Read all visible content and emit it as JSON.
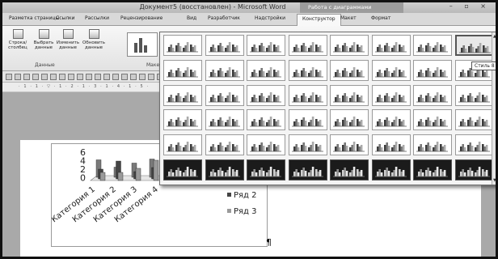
{
  "window": {
    "title": "Документ5 (восстановлен) - Microsoft Word",
    "context_tab_group": "Работа с диаграммами",
    "controls": "– ▫ ×"
  },
  "tabs": [
    {
      "label": "Разметка страницы",
      "active": false
    },
    {
      "label": "Ссылки",
      "active": false
    },
    {
      "label": "Рассылки",
      "active": false
    },
    {
      "label": "Рецензирование",
      "active": false
    },
    {
      "label": "Вид",
      "active": false
    },
    {
      "label": "Разработчик",
      "active": false
    },
    {
      "label": "Надстройки",
      "active": false
    },
    {
      "label": "Конструктор",
      "active": true
    },
    {
      "label": "Макет",
      "active": false
    },
    {
      "label": "Формат",
      "active": false
    }
  ],
  "ribbon": {
    "buttons": [
      {
        "label": "Строка/столбец",
        "icon": "switch-row-column-icon"
      },
      {
        "label": "Выбрать данные",
        "icon": "select-data-icon"
      },
      {
        "label": "Изменить данные",
        "icon": "edit-data-icon"
      },
      {
        "label": "Обновить данные",
        "icon": "refresh-data-icon"
      }
    ],
    "group_data_label": "Данные",
    "group_layouts_label": "Макет"
  },
  "ruler_text": "· 1 · 1 · ▽ · 1 · 2 · 1 · 3 · 1 · 4 · 1 · 5 ·",
  "chart": {
    "legend": [
      {
        "label": "Ряд 2",
        "color": "#444444"
      },
      {
        "label": "Ряд 3",
        "color": "#9a9a9a"
      }
    ],
    "paragraph_mark": "¶"
  },
  "chart_data": {
    "type": "bar",
    "categories": [
      "Категория 1",
      "Категория 2",
      "Категория 3",
      "Категория 4"
    ],
    "series": [
      {
        "name": "",
        "values": [
          4.3,
          2.5,
          3.5,
          4.5
        ]
      },
      {
        "name": "Ряд 2",
        "values": [
          2.4,
          4.4,
          1.8,
          2.8
        ]
      },
      {
        "name": "Ряд 3",
        "values": [
          2,
          2,
          3,
          5
        ]
      }
    ],
    "y_ticks": [
      "6",
      "4",
      "2",
      "0"
    ],
    "ylim": [
      0,
      6
    ]
  },
  "gallery": {
    "rows": 6,
    "cols": 8,
    "hovered_style": "Стиль 8",
    "tooltip": "Стиль 8"
  }
}
